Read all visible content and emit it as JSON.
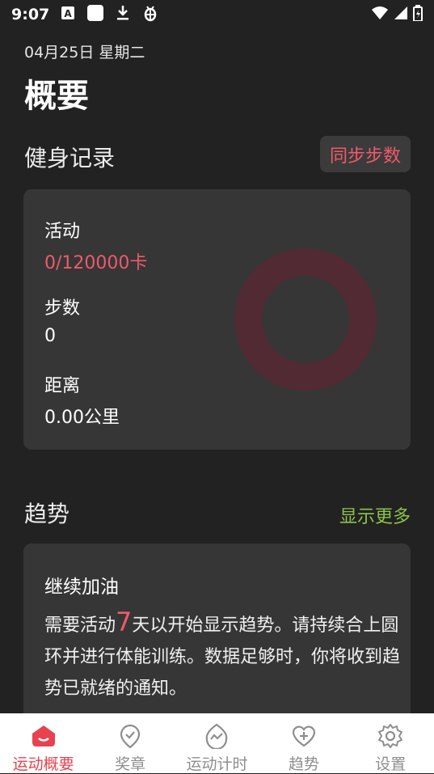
{
  "status_bar": {
    "time": "9:07",
    "icons": [
      "text-a-icon",
      "blank-square-icon",
      "download-icon",
      "bug-icon",
      "wifi-icon",
      "signal-icon",
      "battery-icon"
    ]
  },
  "header": {
    "date": "04月25日 星期二",
    "title": "概要"
  },
  "fitness": {
    "section_title": "健身记录",
    "sync_label": "同步步数",
    "activity_label": "活动",
    "activity_value": "0/120000卡",
    "steps_label": "步数",
    "steps_value": "0",
    "distance_label": "距离",
    "distance_value": "0.00公里",
    "ring_progress": 0
  },
  "trends": {
    "section_title": "趋势",
    "more_label": "显示更多",
    "card_title": "继续加油",
    "body_prefix": "需要活动",
    "days": "7",
    "body_suffix": "天以开始显示趋势。请持续合上圆环并进行体能训练。数据足够时，你将收到趋势已就绪的通知。"
  },
  "tabbar": {
    "items": [
      {
        "label": "运动概要",
        "icon": "home-icon",
        "active": true
      },
      {
        "label": "奖章",
        "icon": "badge-icon",
        "active": false
      },
      {
        "label": "运动计时",
        "icon": "timer-icon",
        "active": false
      },
      {
        "label": "趋势",
        "icon": "heart-plus-icon",
        "active": false
      },
      {
        "label": "设置",
        "icon": "gear-icon",
        "active": false
      }
    ]
  },
  "colors": {
    "background": "#222222",
    "card": "#363636",
    "accent_red": "#ee5a6b",
    "accent_green": "#8bc34a",
    "ring_track": "#522a33"
  }
}
